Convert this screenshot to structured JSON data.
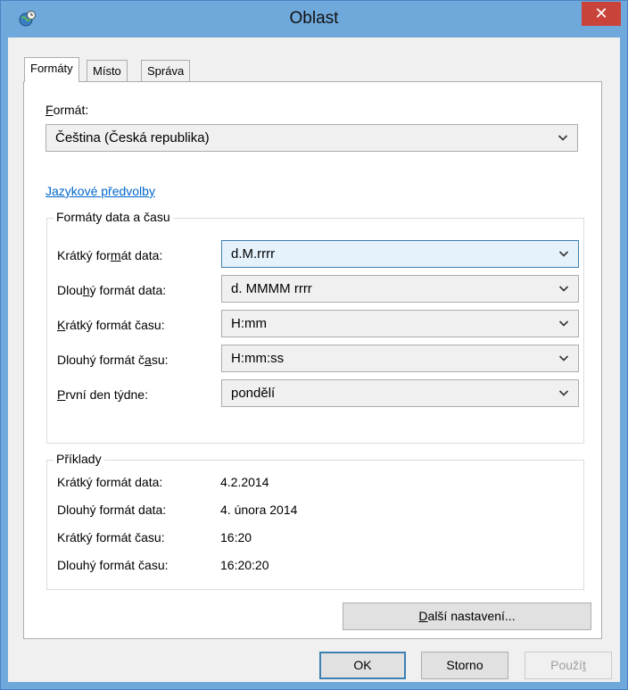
{
  "window": {
    "title": "Oblast",
    "close_glyph": "✕"
  },
  "tabs": [
    {
      "label": "Formáty",
      "active": true
    },
    {
      "label": "Místo",
      "active": false
    },
    {
      "label": "Správa",
      "active": false
    }
  ],
  "format": {
    "label_prefix": "F",
    "label_rest": "ormát:",
    "value": "Čeština (Česká republika)"
  },
  "language_link": "Jazykové předvolby",
  "datetime_group": {
    "title": "Formáty data a času",
    "rows": [
      {
        "label_a": "Krátký for",
        "label_u": "m",
        "label_b": "át data:",
        "value": "d.M.rrrr"
      },
      {
        "label_a": "Dlou",
        "label_u": "h",
        "label_b": "ý formát data:",
        "value": "d. MMMM rrrr"
      },
      {
        "label_a": "",
        "label_u": "K",
        "label_b": "rátký formát času:",
        "value": "H:mm"
      },
      {
        "label_a": "Dlouhý formát č",
        "label_u": "a",
        "label_b": "su:",
        "value": "H:mm:ss"
      },
      {
        "label_a": "",
        "label_u": "P",
        "label_b": "rvní den týdne:",
        "value": "pondělí"
      }
    ]
  },
  "examples_group": {
    "title": "Příklady",
    "rows": [
      {
        "label": "Krátký formát data:",
        "value": "4.2.2014"
      },
      {
        "label": "Dlouhý formát data:",
        "value": "4. února 2014"
      },
      {
        "label": "Krátký formát času:",
        "value": "16:20"
      },
      {
        "label": "Dlouhý formát času:",
        "value": "16:20:20"
      }
    ]
  },
  "buttons": {
    "more_settings_u": "D",
    "more_settings_rest": "alší nastavení...",
    "ok": "OK",
    "cancel": "Storno",
    "apply_a": "Použí",
    "apply_u": "t"
  },
  "icons": {
    "app": "globe-clock-icon",
    "close": "close-icon",
    "dropdown": "chevron-down-icon"
  },
  "colors": {
    "titlebar": "#6fa9dc",
    "close": "#c9433a",
    "link": "#0066cc",
    "focus": "#3c7fb1"
  }
}
